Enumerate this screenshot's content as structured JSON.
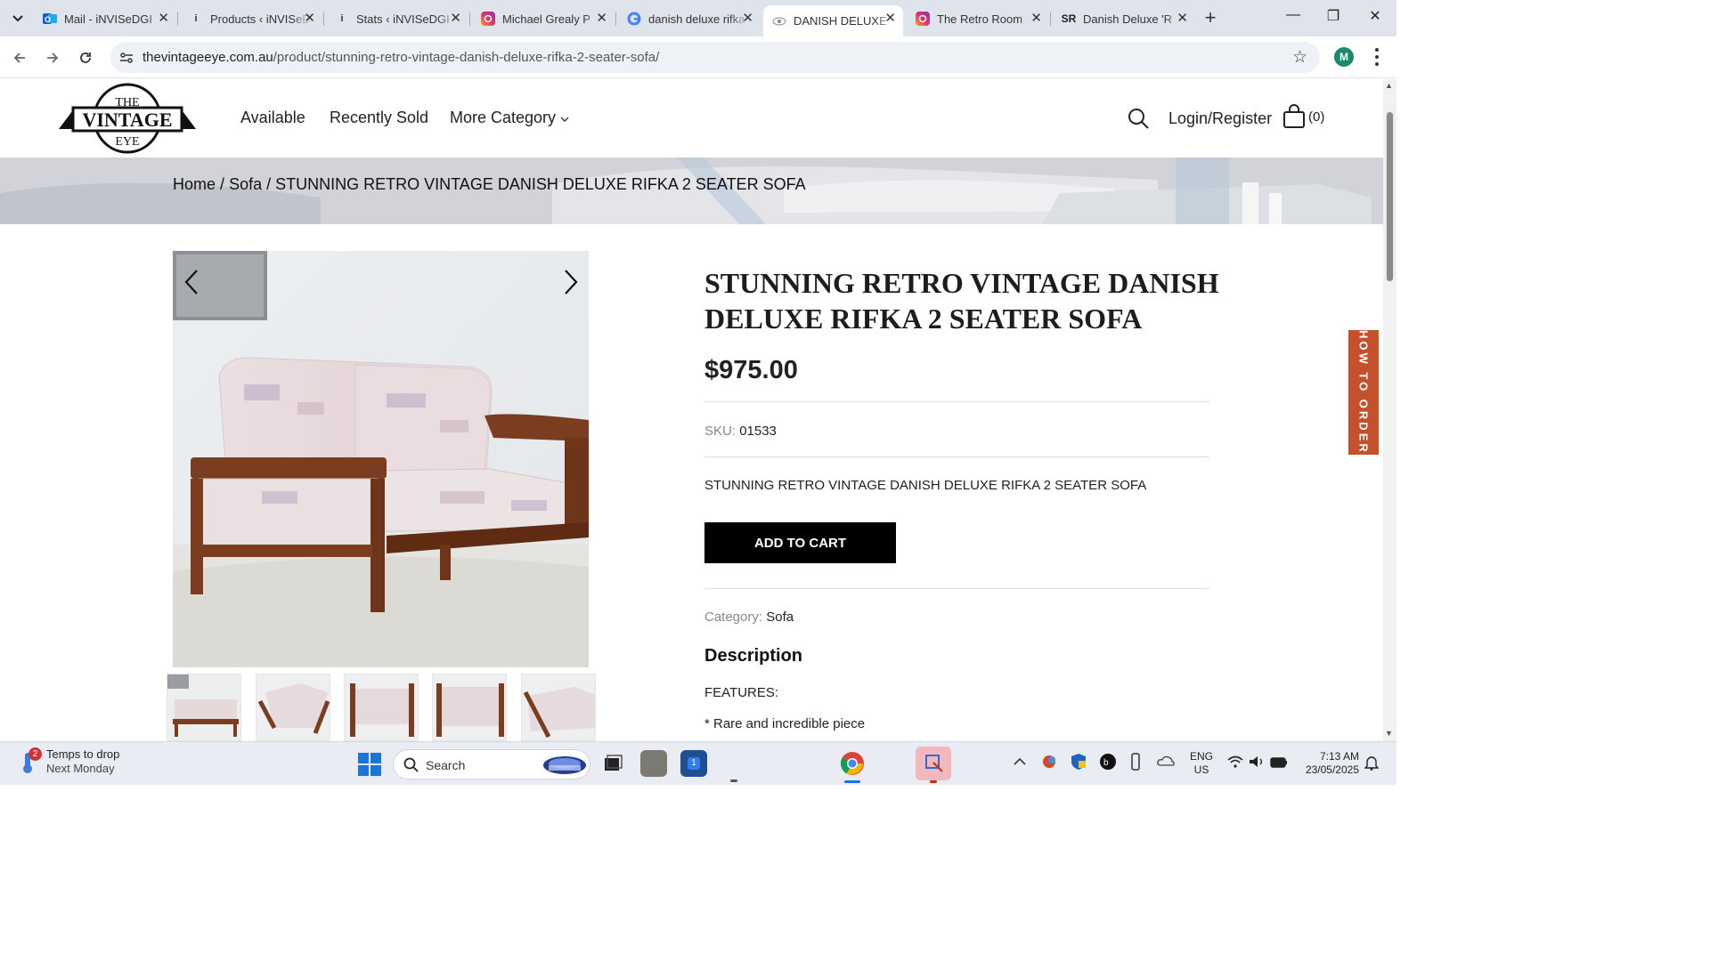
{
  "browser": {
    "tabs": [
      {
        "title": "Mail - iNVISeDGI",
        "icon": "outlook-icon"
      },
      {
        "title": "Products ‹ iNVISeDGI",
        "icon": "info-icon"
      },
      {
        "title": "Stats ‹ iNVISeDGI",
        "icon": "info-icon"
      },
      {
        "title": "Michael Grealy P",
        "icon": "instagram-icon"
      },
      {
        "title": "danish deluxe rifka",
        "icon": "google-icon"
      },
      {
        "title": "DANISH DELUXE",
        "icon": "vintage-eye-icon",
        "active": true
      },
      {
        "title": "The Retro Room",
        "icon": "instagram-icon"
      },
      {
        "title": "Danish Deluxe 'R",
        "icon": "sr-icon"
      }
    ],
    "address": {
      "host": "thevintageeye.com.au",
      "path": "/product/stunning-retro-vintage-danish-deluxe-rifka-2-seater-sofa/"
    },
    "profile_initial": "M"
  },
  "site": {
    "nav": {
      "available": "Available",
      "recently_sold": "Recently Sold",
      "more_category": "More Category"
    },
    "login": "Login/Register",
    "cart_count": "(0)",
    "how_to_order": "HOW TO ORDER"
  },
  "breadcrumb": {
    "home": "Home",
    "sep1": "/",
    "category": "Sofa",
    "sep2": "/",
    "current": "STUNNING RETRO VINTAGE DANISH DELUXE RIFKA 2 SEATER SOFA"
  },
  "product": {
    "title": "STUNNING RETRO VINTAGE DANISH DELUXE RIFKA 2 SEATER SOFA",
    "price": "$975.00",
    "sku_label": "SKU:",
    "sku": "01533",
    "short_description": "STUNNING RETRO VINTAGE DANISH DELUXE RIFKA 2 SEATER SOFA",
    "add_to_cart": "ADD TO CART",
    "category_label": "Category:",
    "category": "Sofa",
    "description_heading": "Description",
    "features_label": "FEATURES:",
    "feature_1": "* Rare and incredible piece"
  },
  "taskbar": {
    "weather_title": "Temps to drop",
    "weather_sub": "Next Monday",
    "weather_badge": "2",
    "search_label": "Search",
    "lang_1": "ENG",
    "lang_2": "US",
    "time": "7:13 AM",
    "date": "23/05/2025",
    "app_badge": "1"
  },
  "colors": {
    "accent_tab": "#c5502c",
    "button": "#000000",
    "taskbar": "#e9ecf2"
  }
}
